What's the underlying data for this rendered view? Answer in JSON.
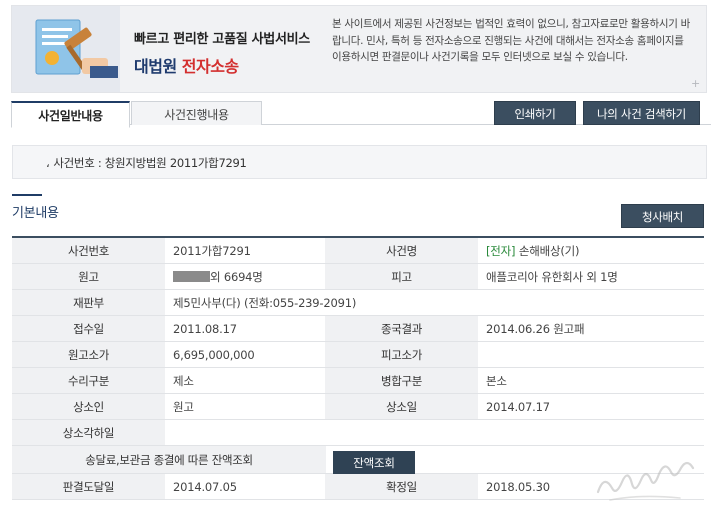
{
  "banner": {
    "line1": "빠르고 편리한 고품질 사법서비스",
    "court": "대법원",
    "ecase": "전자소송",
    "notice": "본 사이트에서 제공된 사건정보는 법적인 효력이 없으니, 참고자료로만 활용하시기 바랍니다. 민사, 특허 등 전자소송으로 진행되는 사건에 대해서는 전자소송 홈페이지를 이용하시면 판결문이나 사건기록을 모두 인터넷으로 보실 수 있습니다.",
    "plus": "+"
  },
  "tabs": {
    "general": "사건일반내용",
    "progress": "사건진행내용"
  },
  "buttons": {
    "print": "인쇄하기",
    "my_case": "나의 사건 검색하기",
    "claim": "청사배치",
    "remain": "잔액조회"
  },
  "case_header": {
    "bullet": "،",
    "text": "사건번호 : 창원지방법원 2011가합7291"
  },
  "section_title": "기본내용",
  "table": {
    "case_no_label": "사건번호",
    "case_no": "2011가합7291",
    "case_name_label": "사건명",
    "case_name_tag": "[전자]",
    "case_name": "손해배상(기)",
    "plaintiff_label": "원고",
    "plaintiff_suffix": "외 6694명",
    "defendant_label": "피고",
    "defendant": "애플코리아 유한회사 외 1명",
    "division_label": "재판부",
    "division": "제5민사부(다) (전화:055-239-2091)",
    "received_label": "접수일",
    "received": "2011.08.17",
    "result_label": "종국결과",
    "result": "2014.06.26 원고패",
    "plaintiff_claim_label": "원고소가",
    "plaintiff_claim": "6,695,000,000",
    "defendant_claim_label": "피고소가",
    "defendant_claim": "",
    "receipt_type_label": "수리구분",
    "receipt_type": "제소",
    "merge_label": "병합구분",
    "merge": "본소",
    "appellant_label": "상소인",
    "appellant": "원고",
    "appeal_date_label": "상소일",
    "appeal_date": "2014.07.17",
    "appeal_reject_label": "상소각하일",
    "appeal_reject": "",
    "deposit_label": "송달료,보관금 종결에 따른 잔액조회",
    "judgment_delivered_label": "판결도달일",
    "judgment_delivered": "2014.07.05",
    "finalized_label": "확정일",
    "finalized": "2018.05.30"
  },
  "colors": {
    "navy": "#1f3c66",
    "button_dark": "#3b4e60",
    "accent_red": "#d32f2f",
    "ecase_green": "#2a8a3b"
  }
}
